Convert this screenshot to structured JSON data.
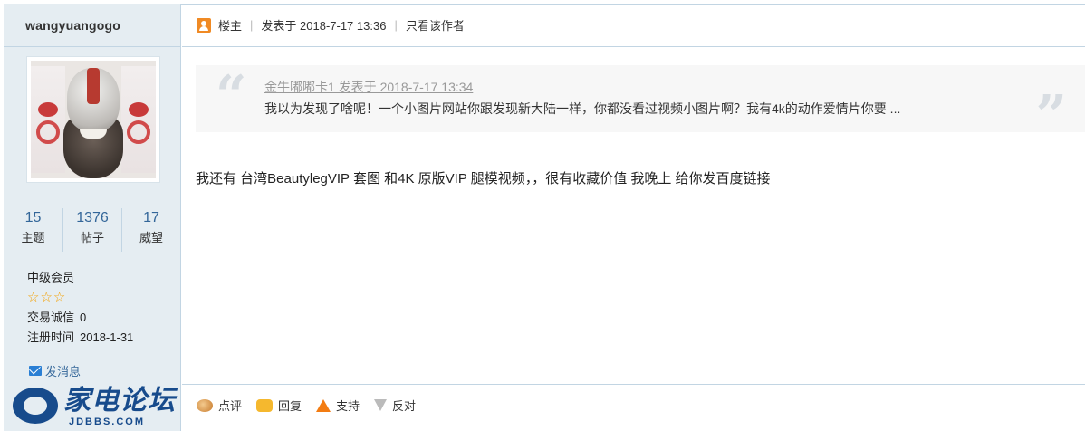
{
  "author": {
    "username": "wangyuangogo",
    "stats": [
      {
        "value": "15",
        "label": "主题"
      },
      {
        "value": "1376",
        "label": "帖子"
      },
      {
        "value": "17",
        "label": "威望"
      }
    ],
    "rank": "中级会员",
    "stars": "☆☆☆",
    "credit_label": "交易诚信",
    "credit_value": "0",
    "reg_label": "注册时间",
    "reg_date": "2018-1-31",
    "message_link": "发消息"
  },
  "site_logo": {
    "text": "家电论坛",
    "sub": "JDBBS.COM"
  },
  "post_header": {
    "floor": "楼主",
    "posted": "发表于 2018-7-17 13:36",
    "only_author": "只看该作者"
  },
  "quote": {
    "author_line": "金牛嘟嘟卡1 发表于 2018-7-17 13:34",
    "text": "我以为发现了啥呢！一个小图片网站你跟发现新大陆一样，你都没看过视频小图片啊？我有4k的动作爱情片你要 ...",
    "open_mark": "“",
    "close_mark": "”"
  },
  "post": {
    "content": "我还有 台湾BeautylegVIP 套图 和4K 原版VIP 腿模视频，，很有收藏价值  我晚上 给你发百度链接"
  },
  "actions": [
    {
      "label": "点评",
      "icon": "comment-icon"
    },
    {
      "label": "回复",
      "icon": "reply-icon"
    },
    {
      "label": "支持",
      "icon": "thumb-up-icon"
    },
    {
      "label": "反对",
      "icon": "thumb-down-icon"
    }
  ],
  "colors": {
    "sidebar_bg": "#e5edf2",
    "border": "#c2d5e3",
    "link": "#336699",
    "star": "#f4a000",
    "op_icon": "#f08a24"
  }
}
